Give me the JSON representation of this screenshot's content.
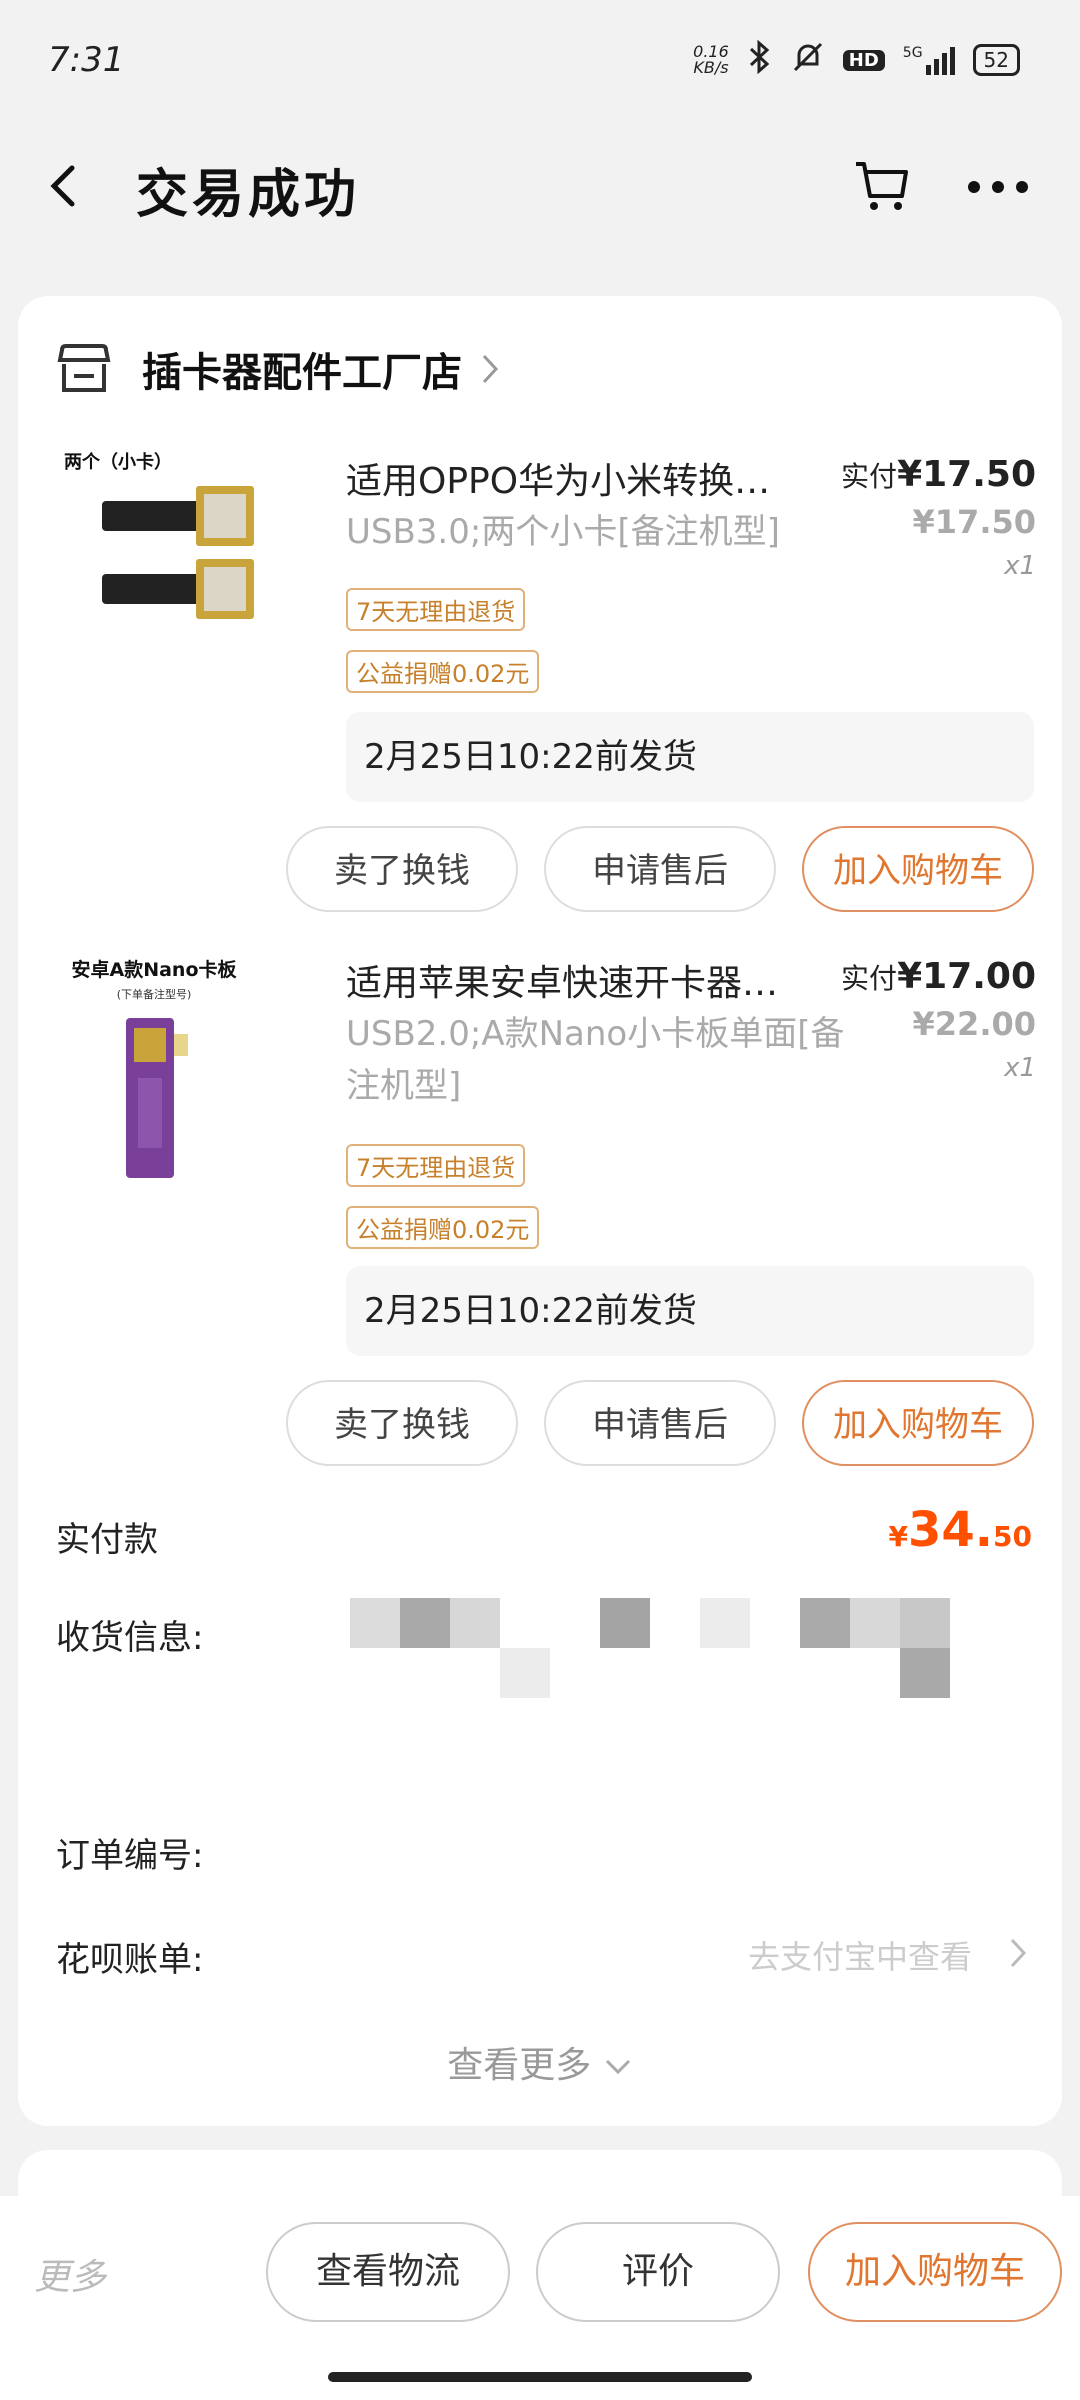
{
  "status_bar": {
    "time": "7:31",
    "net_speed_value": "0.16",
    "net_speed_unit": "KB/s",
    "network": "5G",
    "hd": "HD",
    "battery": "52"
  },
  "header": {
    "title": "交易成功"
  },
  "shop": {
    "name": "插卡器配件工厂店"
  },
  "items": [
    {
      "thumb_label": "两个（小卡）",
      "title": "适用OPPO华为小米转换…",
      "spec": "USB3.0;两个小卡[备注机型]",
      "tag_return": "7天无理由退货",
      "tag_charity": "公益捐赠0.02元",
      "paid_label": "实付",
      "paid_symbol": "¥",
      "paid_amount": "17.50",
      "original_price": "¥17.50",
      "quantity": "x1",
      "ship_text": "2月25日10:22前发货",
      "btn_sell": "卖了换钱",
      "btn_aftersale": "申请售后",
      "btn_add_cart": "加入购物车"
    },
    {
      "thumb_label": "安卓A款Nano卡板",
      "thumb_sublabel": "(下单备注型号)",
      "title": "适用苹果安卓快速开卡器…",
      "spec": "USB2.0;A款Nano小卡板单面[备注机型]",
      "tag_return": "7天无理由退货",
      "tag_charity": "公益捐赠0.02元",
      "paid_label": "实付",
      "paid_symbol": "¥",
      "paid_amount": "17.00",
      "original_price": "¥22.00",
      "quantity": "x1",
      "ship_text": "2月25日10:22前发货",
      "btn_sell": "卖了换钱",
      "btn_aftersale": "申请售后",
      "btn_add_cart": "加入购物车"
    }
  ],
  "summary": {
    "total_label": "实付款",
    "total_symbol": "¥",
    "total_int": "34.",
    "total_dec": "50",
    "shipping_info_label": "收货信息:",
    "order_no_label": "订单编号:",
    "huabei_label": "花呗账单:",
    "huabei_link": "去支付宝中查看",
    "view_more": "查看更多"
  },
  "bottom_bar": {
    "more": "更多",
    "logistics": "查看物流",
    "review": "评价",
    "add_cart": "加入购物车"
  },
  "colors": {
    "accent": "#ff5000",
    "button_orange": "#e0762f",
    "tag_orange": "#c7802b"
  }
}
